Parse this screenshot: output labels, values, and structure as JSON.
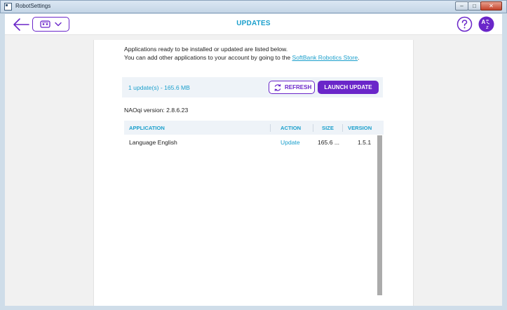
{
  "window": {
    "title": "RobotSettings",
    "controls": [
      "–",
      "□",
      "✕"
    ]
  },
  "header": {
    "title": "UPDATES",
    "icons": [
      "back-arrow-icon",
      "robot-icon",
      "chevron-down-icon",
      "help-icon",
      "language-icon"
    ]
  },
  "intro": {
    "line1": "Applications ready to be installed or updated are listed below.",
    "line2_prefix": "You can add other applications to your account by going to the ",
    "link": "SoftBank Robotics Store",
    "line2_suffix": "."
  },
  "update_bar": {
    "info": "1 update(s) - 165.6 MB",
    "refresh_label": "REFRESH",
    "launch_label": "LAUNCH UPDATE"
  },
  "naoqi": "NAOqi version: 2.8.6.23",
  "table": {
    "columns": [
      "APPLICATION",
      "ACTION",
      "SIZE",
      "VERSION"
    ],
    "rows": [
      {
        "application": "Language English",
        "action": "Update",
        "size": "165.6 ...",
        "version": "1.5.1"
      }
    ]
  },
  "colors": {
    "accent_purple": "#6a26c9",
    "accent_blue": "#1a9fcc"
  }
}
